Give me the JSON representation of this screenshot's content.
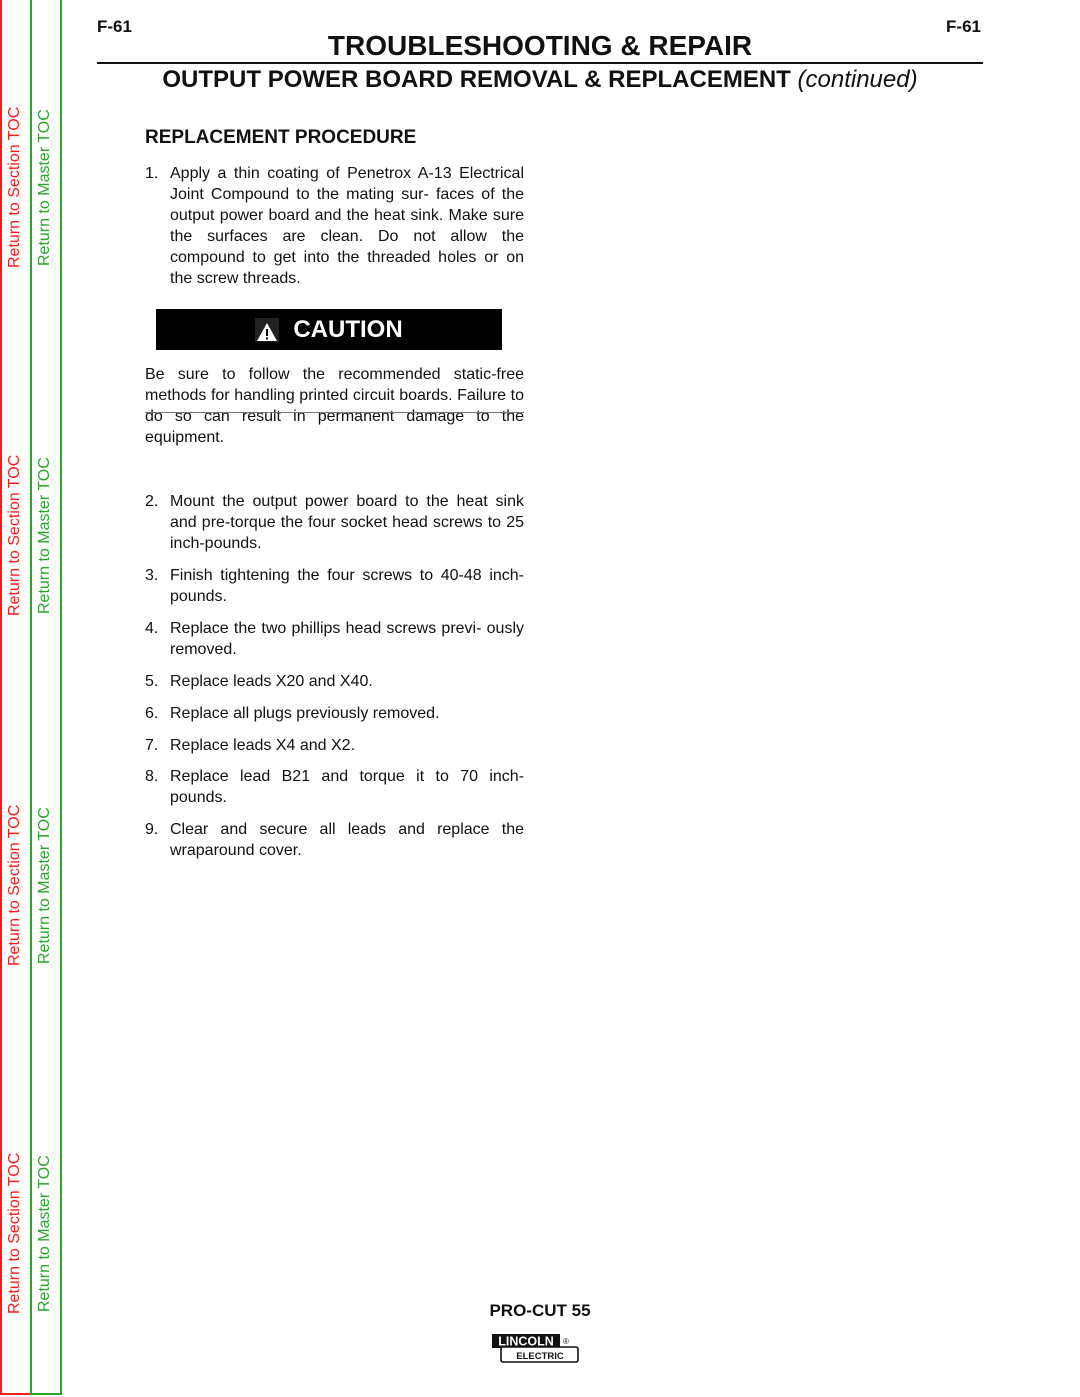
{
  "toc": {
    "section_label": "Return to Section TOC",
    "master_label": "Return to Master TOC",
    "section_color": "#ff1a1a",
    "master_color": "#2aa52a"
  },
  "header": {
    "page_left": "F-61",
    "page_right": "F-61",
    "title": "TROUBLESHOOTING & REPAIR",
    "subtitle": "OUTPUT POWER BOARD REMOVAL & REPLACEMENT",
    "subtitle_suffix": "(continued)"
  },
  "section": {
    "heading": "REPLACEMENT PROCEDURE",
    "steps": [
      {
        "num": "1.",
        "text": "Apply a thin coating of Penetrox A-13 Electrical Joint Compound to the mating sur- faces of the output power board and the heat sink.  Make sure the surfaces are clean.  Do not allow the compound to get into the threaded holes or on the screw threads."
      },
      {
        "num": "2.",
        "text": "Mount the output power board to the heat sink and pre-torque the four socket head screws to 25 inch-pounds."
      },
      {
        "num": "3.",
        "text": "Finish tightening the four screws to 40-48 inch-pounds."
      },
      {
        "num": "4.",
        "text": "Replace the two phillips head screws previ- ously removed."
      },
      {
        "num": "5.",
        "text": "Replace leads X20 and X40."
      },
      {
        "num": "6.",
        "text": "Replace all plugs previously removed."
      },
      {
        "num": "7.",
        "text": "Replace leads X4 and X2."
      },
      {
        "num": "8.",
        "text": "Replace lead B21 and torque it to 70 inch- pounds."
      },
      {
        "num": "9.",
        "text": "Clear and secure all leads and replace the wraparound cover."
      }
    ]
  },
  "caution": {
    "label": "CAUTION",
    "icon": "warning-triangle-icon",
    "text": "Be sure to follow the recommended static-free methods for handling printed circuit boards. Failure to do so can result in permanent damage to the equipment."
  },
  "footer": {
    "model": "PRO-CUT 55",
    "logo_top": "LINCOLN",
    "logo_bottom": "ELECTRIC",
    "logo_mark": "®"
  }
}
